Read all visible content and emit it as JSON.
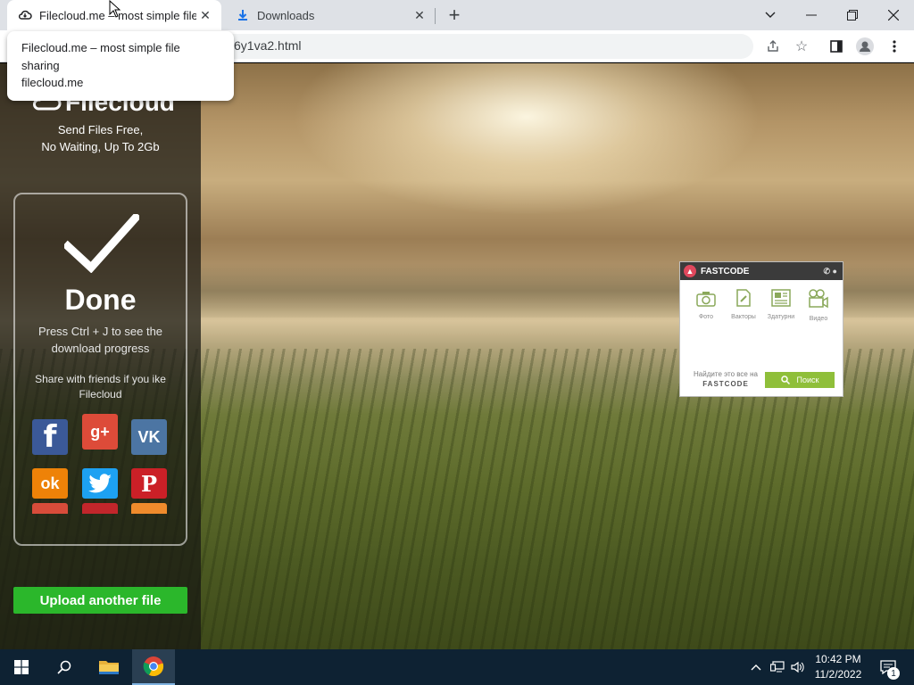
{
  "browser": {
    "tabs": [
      {
        "title": "Filecloud.me – most simple file sharing",
        "active": true
      },
      {
        "title": "Downloads",
        "active": false
      }
    ],
    "url_fragment": "6y1va2.html",
    "tooltip": {
      "title": "Filecloud.me – most simple file sharing",
      "host": "filecloud.me"
    }
  },
  "sidebar": {
    "logo": "Filecloud",
    "tagline_line1": "Send Files Free,",
    "tagline_line2": "No Waiting, Up To 2Gb",
    "done": "Done",
    "press_line1": "Press Ctrl + J to see the",
    "press_line2": "download progress",
    "share_line1": "Share with friends if you ike",
    "share_line2": "Filecloud",
    "social": [
      {
        "name": "facebook",
        "glyph": "f",
        "color": "#3b5998"
      },
      {
        "name": "google-plus",
        "glyph": "g+",
        "color": "#dd4b39"
      },
      {
        "name": "vk",
        "glyph": "VK",
        "color": "#4c75a3"
      },
      {
        "name": "odnoklassniki",
        "glyph": "ok",
        "color": "#ee8208"
      },
      {
        "name": "twitter",
        "glyph": "t",
        "color": "#1da1f2"
      },
      {
        "name": "pinterest",
        "glyph": "P",
        "color": "#cb2027"
      }
    ],
    "upload_button": "Upload another file"
  },
  "fastcode": {
    "brand": "FASTCODE",
    "items": [
      {
        "label": "Фото",
        "icon": "camera-icon",
        "glyph": "📷"
      },
      {
        "label": "Вакторы",
        "icon": "vector-icon",
        "glyph": "✎"
      },
      {
        "label": "Здатурни",
        "icon": "news-icon",
        "glyph": "▤"
      },
      {
        "label": "Видео",
        "icon": "video-icon",
        "glyph": "🎥"
      }
    ],
    "find_text": "Найдите это все на",
    "find_brand": "FASTCODE",
    "search_button": "Поиск"
  },
  "taskbar": {
    "time": "10:42 PM",
    "date": "11/2/2022",
    "notification_count": "1"
  }
}
